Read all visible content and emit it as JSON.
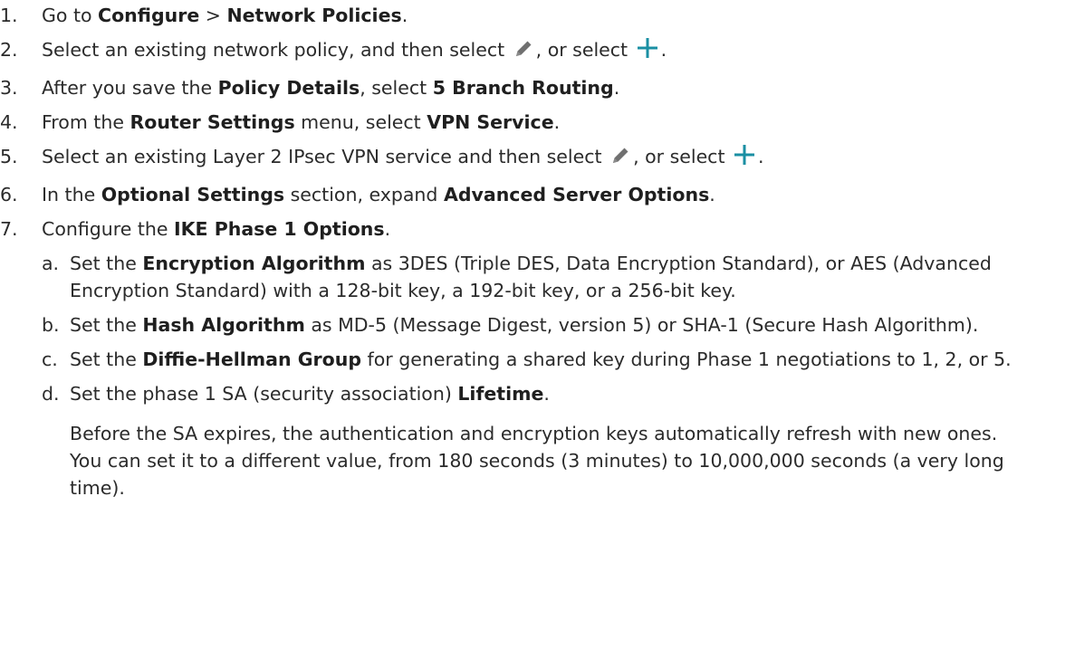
{
  "steps": [
    {
      "num": "1.",
      "parts": [
        "Go to ",
        "Configure",
        " > ",
        "Network Policies",
        "."
      ]
    },
    {
      "num": "2.",
      "parts": [
        "Select an existing network policy, and then select ",
        ", or select ",
        "."
      ],
      "icons": [
        "pencil-icon",
        "plus-icon"
      ]
    },
    {
      "num": "3.",
      "parts": [
        "After you save the ",
        "Policy Details",
        ", select ",
        "5 Branch Routing",
        "."
      ]
    },
    {
      "num": "4.",
      "parts": [
        "From the ",
        "Router Settings",
        " menu, select ",
        "VPN Service",
        "."
      ]
    },
    {
      "num": "5.",
      "parts": [
        "Select an existing Layer 2 IPsec VPN service and then select ",
        ", or select ",
        "."
      ],
      "icons": [
        "pencil-icon",
        "plus-icon"
      ]
    },
    {
      "num": "6.",
      "parts": [
        "In the ",
        "Optional Settings",
        " section, expand ",
        "Advanced Server Options",
        "."
      ]
    },
    {
      "num": "7.",
      "parts": [
        "Configure the ",
        "IKE Phase 1 Options",
        "."
      ],
      "substeps": [
        {
          "letter": "a.",
          "parts": [
            "Set the ",
            "Encryption Algorithm",
            " as 3DES (Triple DES, Data Encryption Standard), or AES (Advanced Encryption Standard) with a 128-bit key, a 192-bit key, or a 256-bit key."
          ]
        },
        {
          "letter": "b.",
          "parts": [
            "Set the ",
            "Hash Algorithm",
            " as MD-5 (Message Digest, version 5) or SHA-1 (Secure Hash Algorithm)."
          ]
        },
        {
          "letter": "c.",
          "parts": [
            "Set the ",
            "Diffie-Hellman Group",
            " for generating a shared key during Phase 1 negotiations to 1, 2, or 5."
          ]
        },
        {
          "letter": "d.",
          "parts": [
            "Set the phase 1 SA (security association) ",
            "Lifetime",
            "."
          ],
          "note": "Before the SA expires, the authentication and encryption keys automatically refresh with new ones. You can set it to a different value, from 180 seconds (3 minutes) to 10,000,000 seconds (a very long time)."
        }
      ]
    }
  ],
  "colors": {
    "text": "#2b2b2b",
    "pencil_icon": "#707070",
    "plus_icon": "#1a8fa3"
  }
}
